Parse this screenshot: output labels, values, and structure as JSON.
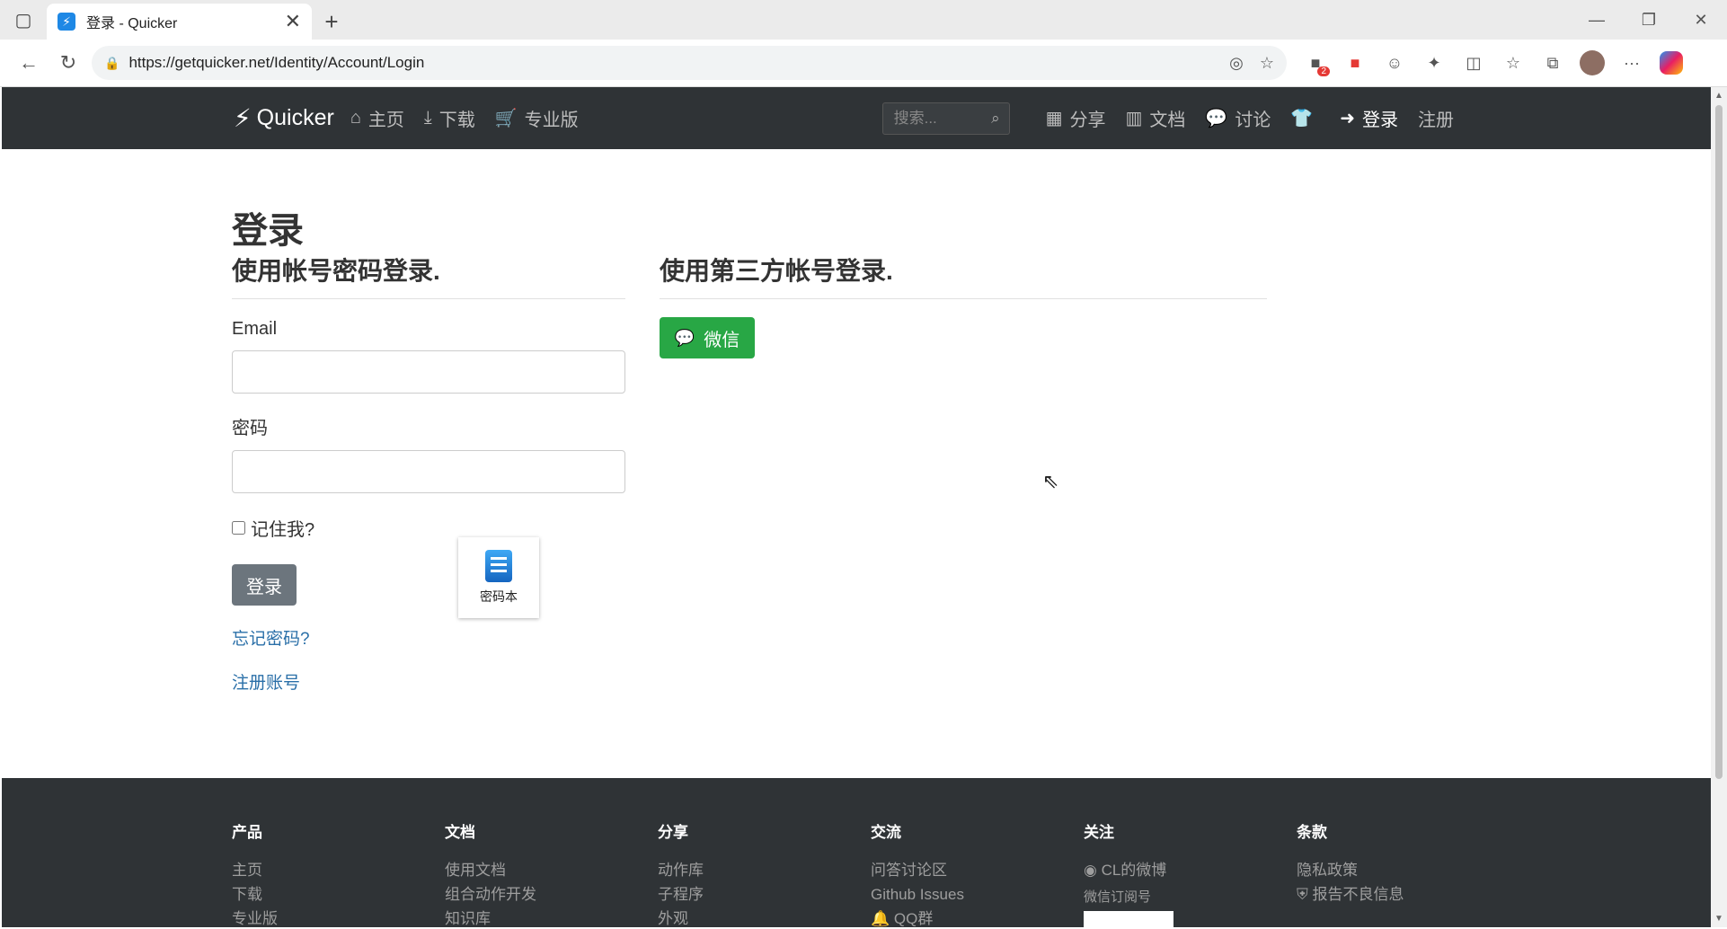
{
  "browser": {
    "tab_title": "登录 - Quicker",
    "url": "https://getquicker.net/Identity/Account/Login",
    "new_tab": "+",
    "close": "✕"
  },
  "header": {
    "brand": "Quicker",
    "nav": [
      {
        "label": "主页",
        "icon": "home-icon"
      },
      {
        "label": "下载",
        "icon": "download-icon"
      },
      {
        "label": "专业版",
        "icon": "cart-icon"
      }
    ],
    "search_placeholder": "搜索...",
    "right_nav": [
      {
        "label": "分享",
        "icon": "grid-icon"
      },
      {
        "label": "文档",
        "icon": "books-icon"
      },
      {
        "label": "讨论",
        "icon": "comments-icon"
      },
      {
        "label": "",
        "icon": "tshirt-icon"
      },
      {
        "label": "登录",
        "icon": "sign-in-icon"
      },
      {
        "label": "注册",
        "icon": ""
      }
    ]
  },
  "page": {
    "title": "登录",
    "local_heading": "使用帐号密码登录.",
    "email_label": "Email",
    "password_label": "密码",
    "remember_label": "记住我?",
    "login_button": "登录",
    "forgot_link": "忘记密码?",
    "register_link": "注册账号",
    "external_heading": "使用第三方帐号登录.",
    "wechat_button": "微信"
  },
  "popup": {
    "label": "密码本"
  },
  "footer": {
    "columns": [
      {
        "title": "产品",
        "items": [
          "主页",
          "下载",
          "专业版"
        ]
      },
      {
        "title": "文档",
        "items": [
          "使用文档",
          "组合动作开发",
          "知识库"
        ]
      },
      {
        "title": "分享",
        "items": [
          "动作库",
          "子程序",
          "外观"
        ]
      },
      {
        "title": "交流",
        "items": [
          "问答讨论区",
          "Github Issues",
          "QQ群"
        ]
      },
      {
        "title": "关注",
        "items": [
          "CL的微博"
        ],
        "sub": "微信订阅号"
      },
      {
        "title": "条款",
        "items": [
          "隐私政策",
          "报告不良信息"
        ]
      }
    ]
  },
  "extensions": {
    "badge_count": "2"
  }
}
